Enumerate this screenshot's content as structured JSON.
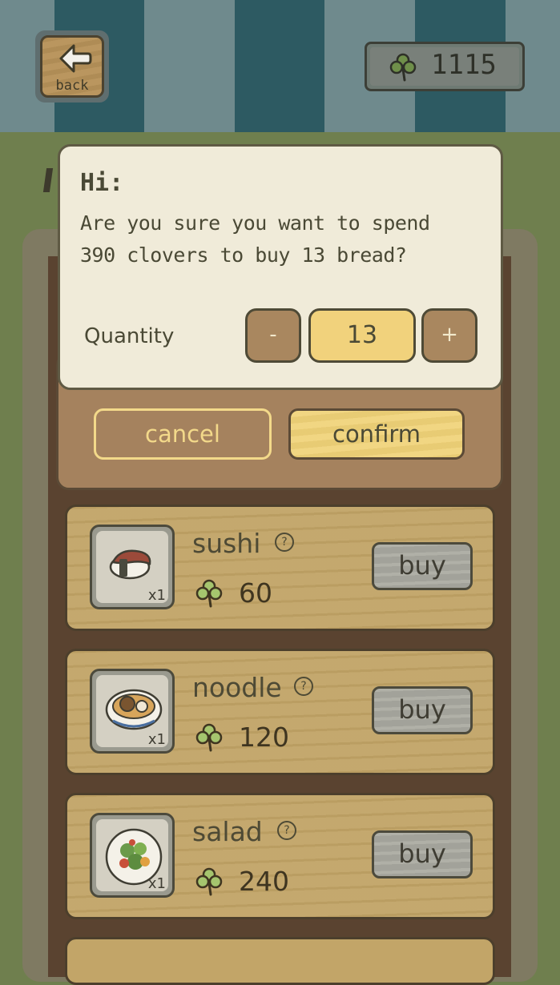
{
  "header": {
    "back_label": "back",
    "currency": {
      "icon": "clover-icon",
      "value": "1115"
    }
  },
  "dialog": {
    "title": "Hi:",
    "message": "Are you sure you want to spend\n390 clovers to buy 13 bread?",
    "quantity_label": "Quantity",
    "minus_label": "-",
    "quantity_value": "13",
    "plus_label": "+",
    "cancel_label": "cancel",
    "confirm_label": "confirm"
  },
  "shop": {
    "items": [
      {
        "name": "sushi",
        "qty": "x1",
        "price": "60",
        "buy_label": "buy",
        "icon": "sushi-icon"
      },
      {
        "name": "noodle",
        "qty": "x1",
        "price": "120",
        "buy_label": "buy",
        "icon": "noodle-bowl-icon"
      },
      {
        "name": "salad",
        "qty": "x1",
        "price": "240",
        "buy_label": "buy",
        "icon": "salad-icon"
      }
    ]
  },
  "colors": {
    "background": "#6f7f4e",
    "dialog_bg": "#f0ebd9",
    "confirm_bg": "#f0d278",
    "wood": "#c2a568",
    "stripe_dark": "#2d5a62",
    "stripe_light": "#6f8a8d"
  }
}
